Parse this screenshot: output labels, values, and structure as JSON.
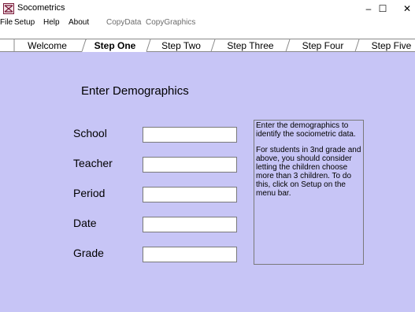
{
  "window": {
    "title": "Socometrics",
    "controls": {
      "minimize": "–",
      "maximize": "☐",
      "close": "✕"
    }
  },
  "menu": {
    "items": [
      {
        "label": "File",
        "enabled": true
      },
      {
        "label": "Setup",
        "enabled": true
      },
      {
        "label": "Help",
        "enabled": true
      },
      {
        "label": "About",
        "enabled": true
      },
      {
        "label": "CopyData",
        "enabled": false
      },
      {
        "label": "CopyGraphics",
        "enabled": false
      }
    ]
  },
  "tabs": [
    {
      "label": "Welcome",
      "active": false
    },
    {
      "label": "Step One",
      "active": true
    },
    {
      "label": "Step Two",
      "active": false
    },
    {
      "label": "Step Three",
      "active": false
    },
    {
      "label": "Step Four",
      "active": false
    },
    {
      "label": "Step Five",
      "active": false
    }
  ],
  "content": {
    "heading": "Enter Demographics",
    "fields": [
      {
        "label": "School",
        "value": ""
      },
      {
        "label": "Teacher",
        "value": ""
      },
      {
        "label": "Period",
        "value": ""
      },
      {
        "label": "Date",
        "value": ""
      },
      {
        "label": "Grade",
        "value": ""
      }
    ],
    "help": {
      "paragraph1": "Enter the demographics to identify the sociometric data.",
      "paragraph2": "For students in 3nd grade and above, you should consider letting the children choose more than 3 children.  To do this, click on Setup on the menu bar."
    }
  },
  "colors": {
    "panel_background": "#c7c5f6",
    "window_background": "#ffffff",
    "disabled_menu_text": "#6d6d6d"
  }
}
